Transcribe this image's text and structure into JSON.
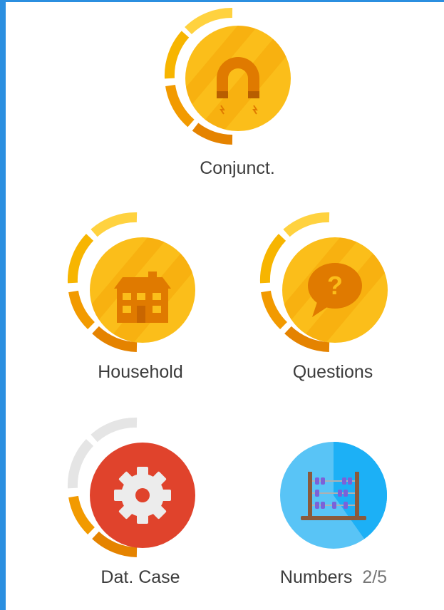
{
  "skills": [
    {
      "name": "Conjunct.",
      "icon": "magnet-icon",
      "color": "gold",
      "progress": 0.75
    },
    {
      "name": "Household",
      "icon": "house-icon",
      "color": "gold",
      "progress": 0.75
    },
    {
      "name": "Questions",
      "icon": "question-bubble-icon",
      "color": "gold",
      "progress": 0.75
    },
    {
      "name": "Dat. Case",
      "icon": "gear-icon",
      "color": "red",
      "progress": 0.25
    },
    {
      "name": "Numbers",
      "icon": "abacus-icon",
      "color": "blue",
      "level": "2/5"
    }
  ],
  "colors": {
    "gold": "#f7b500",
    "gold_light": "#ffd23f",
    "gold_dark": "#e58300",
    "red": "#e0432c",
    "blue": "#59c4f6",
    "blue_dark": "#1cb0f6",
    "ring_gray": "#e5e5e5",
    "label": "#3c3c3c",
    "accent": "#2b8fe0"
  }
}
